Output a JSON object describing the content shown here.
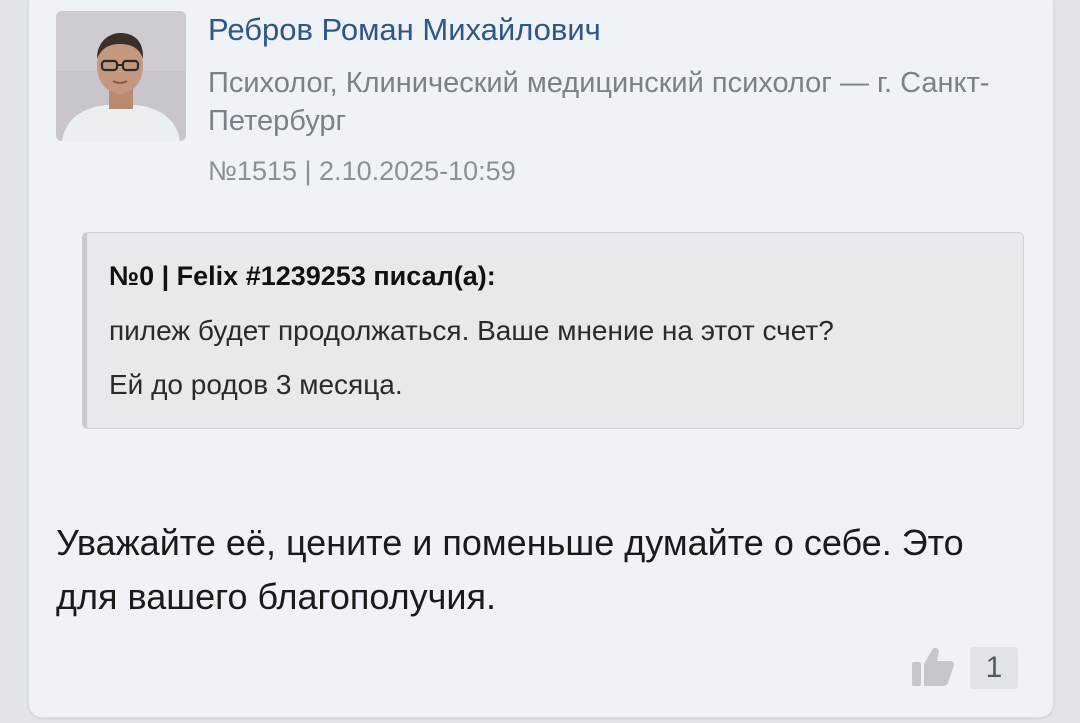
{
  "author": {
    "name": "Ребров Роман Михайлович",
    "title": "Психолог, Клинический медицинский психолог — г. Санкт-Петербург",
    "post_meta": "№1515 | 2.10.2025-10:59"
  },
  "quote": {
    "header": "№0 | Felix #1239253 писал(а):",
    "line1": "пилеж будет продолжаться. Ваше мнение на этот счет?",
    "line2": "Ей до родов 3 месяца."
  },
  "reply": {
    "text": "Уважайте её, цените и поменьше думайте о себе. Это для вашего благополучия."
  },
  "likes": {
    "count": "1",
    "icon": "thumbs-up-icon"
  },
  "colors": {
    "name": "#2f5688",
    "muted": "#7c8188",
    "card_bg": "#eff2f6",
    "quote_bg": "#e7e9ec"
  }
}
